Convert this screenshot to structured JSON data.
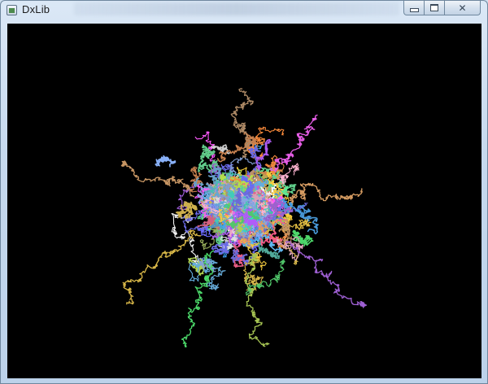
{
  "window": {
    "title": "DxLib",
    "icon": "app-window-icon"
  },
  "caption": {
    "minimize_icon": "minimize-icon",
    "maximize_icon": "maximize-icon",
    "close_icon": "close-icon",
    "close_glyph": "✕"
  },
  "canvas": {
    "background": "#000000",
    "palette": [
      "#ff5a8a",
      "#ff8c3a",
      "#ffd23a",
      "#b8e04a",
      "#4ae06a",
      "#3ad8c0",
      "#3aa8ff",
      "#6a6aff",
      "#b45aff",
      "#ff5aff",
      "#ffffff",
      "#8ab4ff",
      "#5aff9a",
      "#ffb4d2",
      "#e0a060",
      "#60c0ff"
    ]
  }
}
